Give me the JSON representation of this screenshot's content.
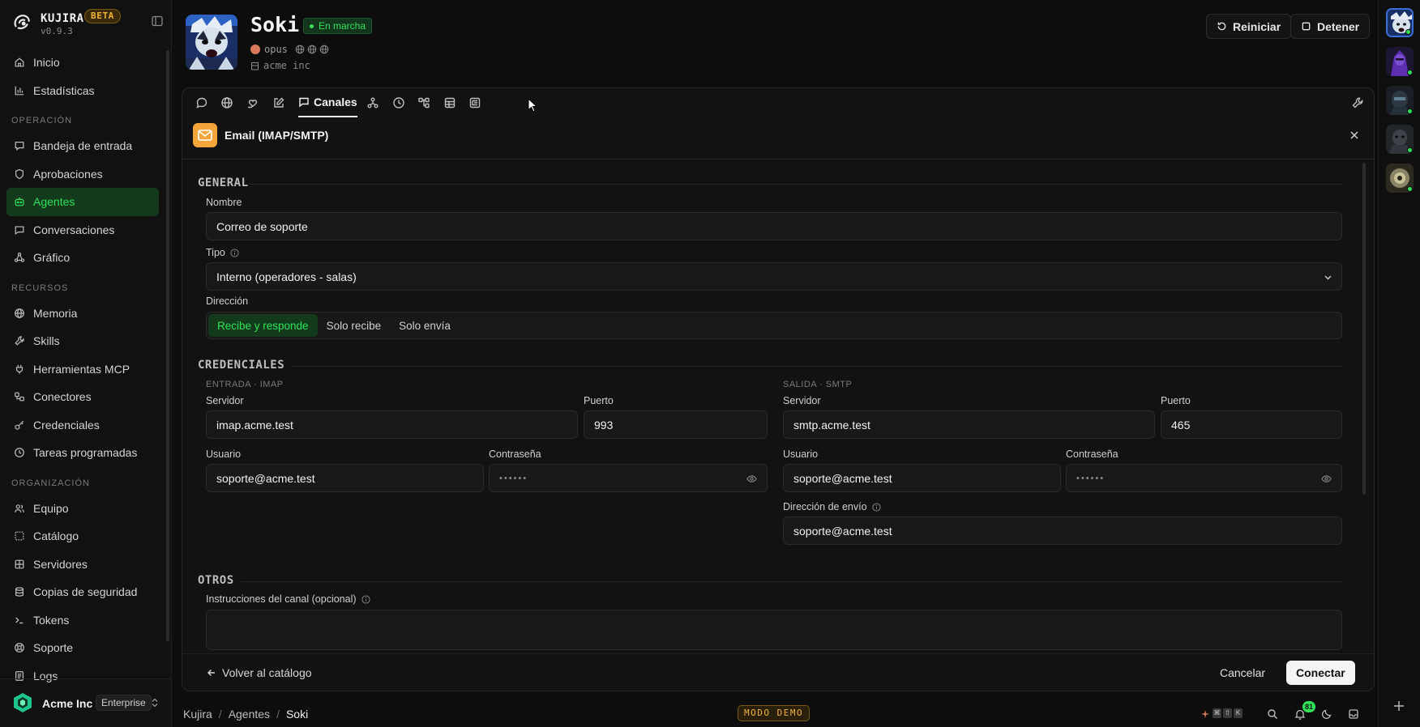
{
  "app": {
    "name": "KUJIRA",
    "badge": "BETA",
    "version": "v0.9.3"
  },
  "sidebar": {
    "items_top": [
      {
        "label": "Inicio",
        "icon": "home-icon"
      },
      {
        "label": "Estadísticas",
        "icon": "bar-chart-icon"
      }
    ],
    "section_operacion": "OPERACIÓN",
    "items_operacion": [
      {
        "label": "Bandeja de entrada",
        "icon": "inbox-icon"
      },
      {
        "label": "Aprobaciones",
        "icon": "shield-icon"
      },
      {
        "label": "Agentes",
        "icon": "bot-icon",
        "active": true
      },
      {
        "label": "Conversaciones",
        "icon": "chat-icon"
      },
      {
        "label": "Gráfico",
        "icon": "graph-icon"
      }
    ],
    "section_recursos": "RECURSOS",
    "items_recursos": [
      {
        "label": "Memoria",
        "icon": "globe-icon"
      },
      {
        "label": "Skills",
        "icon": "wrench-icon"
      },
      {
        "label": "Herramientas MCP",
        "icon": "plug-icon"
      },
      {
        "label": "Conectores",
        "icon": "connector-icon"
      },
      {
        "label": "Credenciales",
        "icon": "key-icon"
      },
      {
        "label": "Tareas programadas",
        "icon": "clock-icon"
      }
    ],
    "section_organizacion": "ORGANIZACIÓN",
    "items_organizacion": [
      {
        "label": "Equipo",
        "icon": "users-icon"
      },
      {
        "label": "Catálogo",
        "icon": "catalog-icon"
      },
      {
        "label": "Servidores",
        "icon": "server-icon"
      },
      {
        "label": "Copias de seguridad",
        "icon": "backup-icon"
      },
      {
        "label": "Tokens",
        "icon": "terminal-icon"
      },
      {
        "label": "Soporte",
        "icon": "support-icon"
      },
      {
        "label": "Logs",
        "icon": "logs-icon"
      }
    ],
    "org": {
      "name": "Acme Inc",
      "plan": "Enterprise"
    }
  },
  "agent": {
    "name": "Soki",
    "status": "En marcha",
    "model": "opus",
    "org": "acme inc",
    "restart_label": "Reiniciar",
    "stop_label": "Detener"
  },
  "tabs": {
    "icons": [
      "chat-icon",
      "globe-icon",
      "heart-hand-icon",
      "edit-icon",
      "channels-icon",
      "network-icon",
      "clock-icon",
      "tree-icon",
      "database-icon",
      "list-tree-icon"
    ],
    "active_label": "Canales"
  },
  "channel": {
    "title": "Email (IMAP/SMTP)",
    "sections": {
      "general": "GENERAL",
      "credentials": "CREDENCIALES",
      "others": "OTROS"
    },
    "name_label": "Nombre",
    "name_value": "Correo de soporte",
    "type_label": "Tipo",
    "type_value": "Interno (operadores - salas)",
    "direction_label": "Dirección",
    "direction_options": [
      "Recibe y responde",
      "Solo recibe",
      "Solo envía"
    ],
    "direction_selected": "Recibe y responde",
    "imap": {
      "heading": "ENTRADA · IMAP",
      "server_label": "Servidor",
      "server": "imap.acme.test",
      "port_label": "Puerto",
      "port": "993",
      "user_label": "Usuario",
      "user": "soporte@acme.test",
      "password_label": "Contraseña",
      "password_mask": "••••••"
    },
    "smtp": {
      "heading": "SALIDA · SMTP",
      "server_label": "Servidor",
      "server": "smtp.acme.test",
      "port_label": "Puerto",
      "port": "465",
      "user_label": "Usuario",
      "user": "soporte@acme.test",
      "password_label": "Contraseña",
      "password_mask": "••••••",
      "from_label": "Dirección de envío",
      "from": "soporte@acme.test"
    },
    "instructions_label": "Instrucciones del canal (opcional)"
  },
  "footer": {
    "back_label": "Volver al catálogo",
    "cancel_label": "Cancelar",
    "connect_label": "Conectar"
  },
  "bottombar": {
    "breadcrumb": [
      "Kujira",
      "Agentes",
      "Soki"
    ],
    "demo_label": "MODO DEMO",
    "notification_count": "81"
  },
  "colors": {
    "accent": "#2ee25a",
    "warning": "#f0b43c",
    "background": "#0d0d0d",
    "email_badge": "#f4a53a"
  }
}
